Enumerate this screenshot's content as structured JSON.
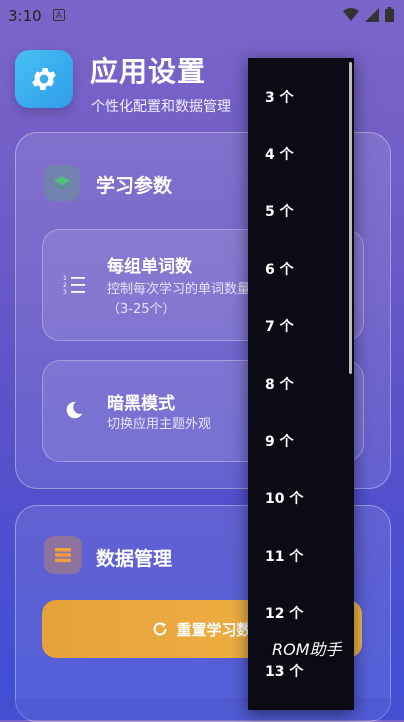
{
  "status_bar": {
    "time": "3:10",
    "notif_badge": "A"
  },
  "header": {
    "title": "应用设置",
    "subtitle": "个性化配置和数据管理",
    "icon": "gear-icon"
  },
  "learning_section": {
    "title": "学习参数",
    "icon": "layers-icon",
    "words_per_group": {
      "title": "每组单词数",
      "description": "控制每次学习的单词数量（3-25个）",
      "icon": "numbered-list-icon"
    },
    "dark_mode": {
      "title": "暗黑模式",
      "description": "切换应用主题外观",
      "icon": "moon-icon",
      "enabled": false
    }
  },
  "data_section": {
    "title": "数据管理",
    "icon": "database-icon",
    "reset_button": "重置学习数"
  },
  "dropdown": {
    "options": [
      "3 个",
      "4 个",
      "5 个",
      "6 个",
      "7 个",
      "8 个",
      "9 个",
      "10 个",
      "11 个",
      "12 个",
      "13 个"
    ]
  },
  "watermark": "ROM助手",
  "colors": {
    "accent_blue": "#2e9be8",
    "reset_orange": "#e6a23a",
    "dropdown_bg": "#0a0b14"
  }
}
